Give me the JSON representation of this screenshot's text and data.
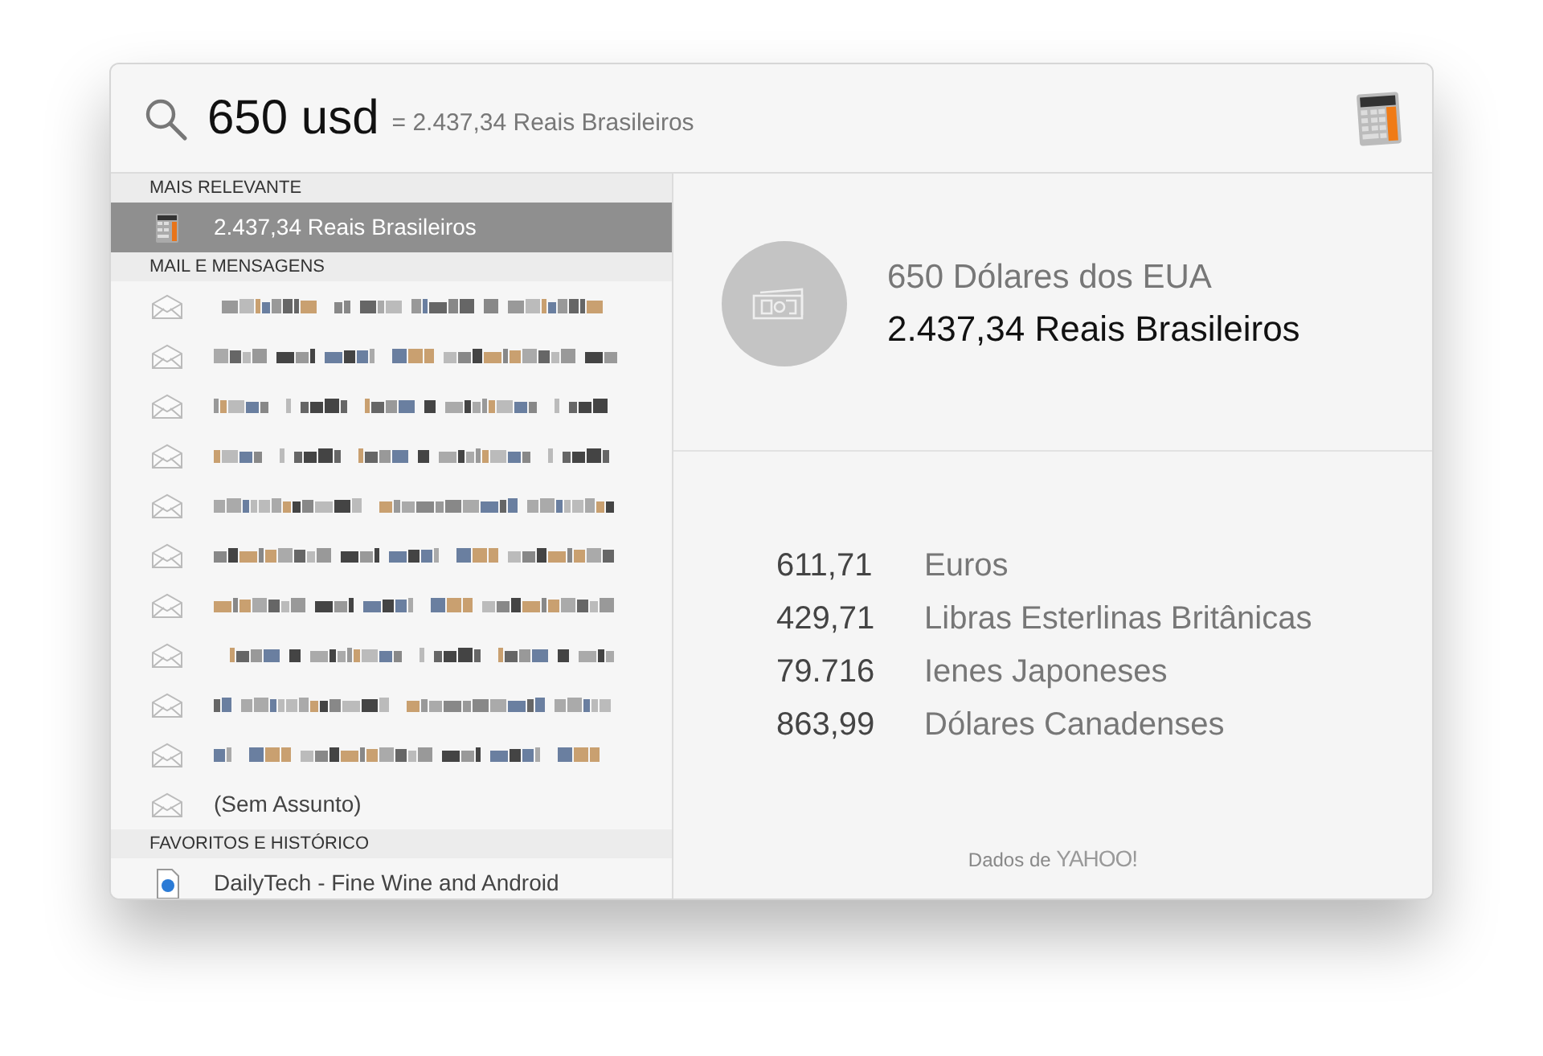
{
  "search": {
    "query": "650 usd",
    "result_hint": "= 2.437,34 Reais Brasileiros"
  },
  "sections": [
    {
      "title": "MAIS RELEVANTE",
      "items": [
        {
          "kind": "calculator",
          "label": "2.437,34 Reais Brasileiros",
          "selected": true
        }
      ]
    },
    {
      "title": "MAIL E MENSAGENS",
      "items": [
        {
          "kind": "mail-blurred",
          "selected": false
        },
        {
          "kind": "mail-blurred",
          "selected": false
        },
        {
          "kind": "mail-blurred",
          "selected": false
        },
        {
          "kind": "mail-blurred",
          "selected": false
        },
        {
          "kind": "mail-blurred",
          "selected": false
        },
        {
          "kind": "mail-blurred",
          "selected": false
        },
        {
          "kind": "mail-blurred",
          "selected": false
        },
        {
          "kind": "mail-blurred",
          "selected": false
        },
        {
          "kind": "mail-blurred",
          "selected": false
        },
        {
          "kind": "mail-blurred",
          "selected": false
        },
        {
          "kind": "mail",
          "label": "(Sem Assunto)",
          "selected": false
        }
      ]
    },
    {
      "title": "FAVORITOS E HISTÓRICO",
      "items": [
        {
          "kind": "web",
          "label": "DailyTech - Fine Wine and Android",
          "selected": false
        }
      ]
    }
  ],
  "preview": {
    "source": "650 Dólares dos EUA",
    "result": "2.437,34 Reais Brasileiros",
    "conversions": [
      {
        "amount": "611,71",
        "currency": "Euros"
      },
      {
        "amount": "429,71",
        "currency": "Libras Esterlinas Britânicas"
      },
      {
        "amount": "79.716",
        "currency": "Ienes Japoneses"
      },
      {
        "amount": "863,99",
        "currency": "Dólares Canadenses"
      }
    ],
    "credit": "Dados de",
    "provider": "YAHOO!"
  }
}
